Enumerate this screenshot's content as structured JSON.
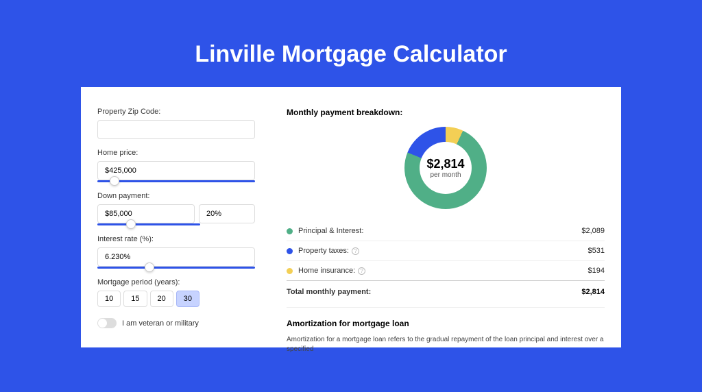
{
  "title": "Linville Mortgage Calculator",
  "form": {
    "zip_label": "Property Zip Code:",
    "zip_value": "",
    "price_label": "Home price:",
    "price_value": "$425,000",
    "down_label": "Down payment:",
    "down_value": "$85,000",
    "down_pct": "20%",
    "rate_label": "Interest rate (%):",
    "rate_value": "6.230%",
    "period_label": "Mortgage period (years):",
    "periods": [
      "10",
      "15",
      "20",
      "30"
    ],
    "period_active": "30",
    "veteran_label": "I am veteran or military"
  },
  "breakdown": {
    "title": "Monthly payment breakdown:",
    "center_value": "$2,814",
    "center_sub": "per month",
    "items": [
      {
        "name": "Principal & Interest:",
        "value": "$2,089",
        "color": "#50af87",
        "help": false
      },
      {
        "name": "Property taxes:",
        "value": "$531",
        "color": "#2e53e8",
        "help": true
      },
      {
        "name": "Home insurance:",
        "value": "$194",
        "color": "#f3cf55",
        "help": true
      }
    ],
    "total_label": "Total monthly payment:",
    "total_value": "$2,814"
  },
  "amort": {
    "title": "Amortization for mortgage loan",
    "text": "Amortization for a mortgage loan refers to the gradual repayment of the loan principal and interest over a specified"
  },
  "colors": {
    "accent": "#2e53e8"
  },
  "chart_data": {
    "type": "pie",
    "title": "Monthly payment breakdown",
    "categories": [
      "Principal & Interest",
      "Property taxes",
      "Home insurance"
    ],
    "values": [
      2089,
      531,
      194
    ],
    "total": 2814
  }
}
